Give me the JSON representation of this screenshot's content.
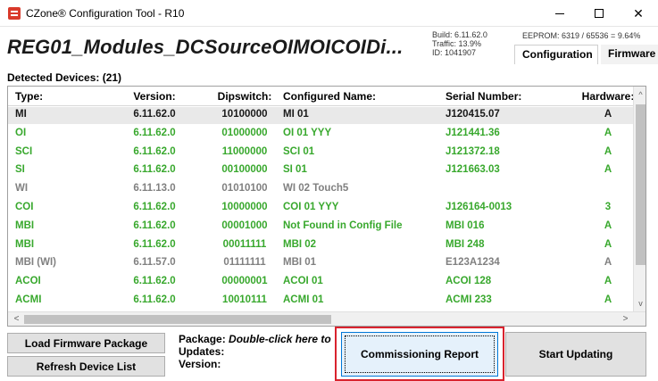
{
  "window": {
    "title": "CZone® Configuration Tool - R10",
    "minimize": "—",
    "maximize": "☐",
    "close": "✕"
  },
  "header": {
    "file_name": "REG01_Modules_DCSourceOIMOICOIDi...",
    "build": "Build: 6.11.62.0",
    "traffic": "Traffic: 13.9%",
    "id": "ID: 1041907",
    "eeprom": "EEPROM: 6319 / 65536 = 9.64%",
    "tabs": [
      {
        "label": "Configuration"
      },
      {
        "label": "Firmware"
      }
    ]
  },
  "devices": {
    "label": "Detected Devices: (21)",
    "columns": [
      "Type:",
      "Version:",
      "Dipswitch:",
      "Configured Name:",
      "Serial Number:",
      "Hardware:"
    ],
    "rows": [
      {
        "type": "MI",
        "version": "6.11.62.0",
        "dipswitch": "10100000",
        "name": "MI 01",
        "serial": "J120415.07",
        "hardware": "A",
        "color": "#1a1a1a"
      },
      {
        "type": "OI",
        "version": "6.11.62.0",
        "dipswitch": "01000000",
        "name": "OI 01 YYY",
        "serial": "J121441.36",
        "hardware": "A",
        "color": "#38a82d"
      },
      {
        "type": "SCI",
        "version": "6.11.62.0",
        "dipswitch": "11000000",
        "name": "SCI 01",
        "serial": "J121372.18",
        "hardware": "A",
        "color": "#38a82d"
      },
      {
        "type": "SI",
        "version": "6.11.62.0",
        "dipswitch": "00100000",
        "name": "SI 01",
        "serial": "J121663.03",
        "hardware": "A",
        "color": "#38a82d"
      },
      {
        "type": "WI",
        "version": "6.11.13.0",
        "dipswitch": "01010100",
        "name": "WI 02 Touch5",
        "serial": "",
        "hardware": "",
        "color": "#808080"
      },
      {
        "type": "COI",
        "version": "6.11.62.0",
        "dipswitch": "10000000",
        "name": "COI 01 YYY",
        "serial": "J126164-0013",
        "hardware": "3",
        "color": "#38a82d"
      },
      {
        "type": "MBI",
        "version": "6.11.62.0",
        "dipswitch": "00001000",
        "name": "Not Found in Config File",
        "serial": "MBI 016",
        "hardware": "A",
        "color": "#38a82d"
      },
      {
        "type": "MBI",
        "version": "6.11.62.0",
        "dipswitch": "00011111",
        "name": "MBI 02",
        "serial": "MBI 248",
        "hardware": "A",
        "color": "#38a82d"
      },
      {
        "type": "MBI (WI)",
        "version": "6.11.57.0",
        "dipswitch": "01111111",
        "name": "MBI 01",
        "serial": "E123A1234",
        "hardware": "A",
        "color": "#808080"
      },
      {
        "type": "ACOI",
        "version": "6.11.62.0",
        "dipswitch": "00000001",
        "name": "ACOI 01",
        "serial": "ACOI 128",
        "hardware": "A",
        "color": "#38a82d"
      },
      {
        "type": "ACMI",
        "version": "6.11.62.0",
        "dipswitch": "10010111",
        "name": "ACMI 01",
        "serial": "ACMI 233",
        "hardware": "A",
        "color": "#38a82d"
      }
    ]
  },
  "scroll": {
    "up": "^",
    "down": "v",
    "left": "<",
    "right": ">"
  },
  "actions": {
    "load_firmware": "Load Firmware Package",
    "refresh": "Refresh Device List",
    "commissioning_report": "Commissioning Report",
    "start_updating": "Start Updating"
  },
  "package": {
    "package_label": "Package:",
    "package_value": "Double-click here to",
    "updates_label": "Updates:",
    "version_label": "Version:"
  }
}
